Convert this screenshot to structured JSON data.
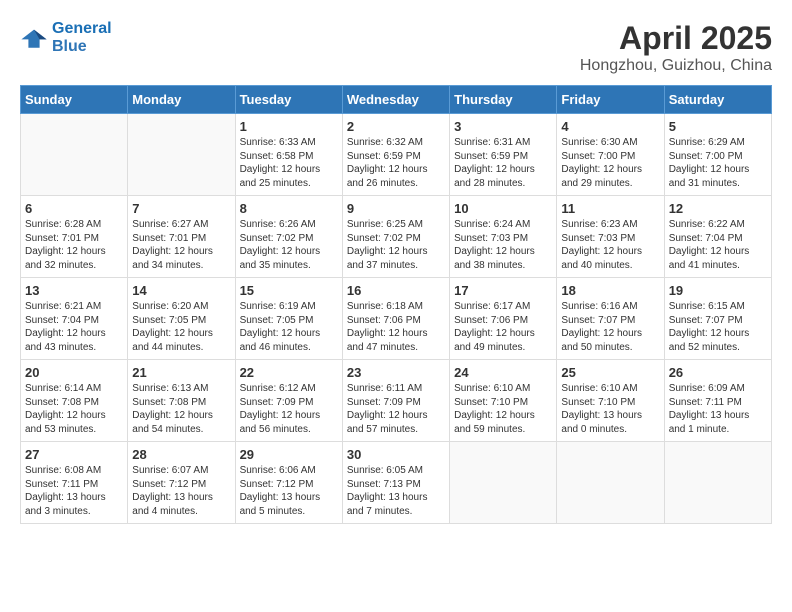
{
  "header": {
    "logo_line1": "General",
    "logo_line2": "Blue",
    "month": "April 2025",
    "location": "Hongzhou, Guizhou, China"
  },
  "days_of_week": [
    "Sunday",
    "Monday",
    "Tuesday",
    "Wednesday",
    "Thursday",
    "Friday",
    "Saturday"
  ],
  "weeks": [
    [
      {
        "day": "",
        "info": ""
      },
      {
        "day": "",
        "info": ""
      },
      {
        "day": "1",
        "info": "Sunrise: 6:33 AM\nSunset: 6:58 PM\nDaylight: 12 hours\nand 25 minutes."
      },
      {
        "day": "2",
        "info": "Sunrise: 6:32 AM\nSunset: 6:59 PM\nDaylight: 12 hours\nand 26 minutes."
      },
      {
        "day": "3",
        "info": "Sunrise: 6:31 AM\nSunset: 6:59 PM\nDaylight: 12 hours\nand 28 minutes."
      },
      {
        "day": "4",
        "info": "Sunrise: 6:30 AM\nSunset: 7:00 PM\nDaylight: 12 hours\nand 29 minutes."
      },
      {
        "day": "5",
        "info": "Sunrise: 6:29 AM\nSunset: 7:00 PM\nDaylight: 12 hours\nand 31 minutes."
      }
    ],
    [
      {
        "day": "6",
        "info": "Sunrise: 6:28 AM\nSunset: 7:01 PM\nDaylight: 12 hours\nand 32 minutes."
      },
      {
        "day": "7",
        "info": "Sunrise: 6:27 AM\nSunset: 7:01 PM\nDaylight: 12 hours\nand 34 minutes."
      },
      {
        "day": "8",
        "info": "Sunrise: 6:26 AM\nSunset: 7:02 PM\nDaylight: 12 hours\nand 35 minutes."
      },
      {
        "day": "9",
        "info": "Sunrise: 6:25 AM\nSunset: 7:02 PM\nDaylight: 12 hours\nand 37 minutes."
      },
      {
        "day": "10",
        "info": "Sunrise: 6:24 AM\nSunset: 7:03 PM\nDaylight: 12 hours\nand 38 minutes."
      },
      {
        "day": "11",
        "info": "Sunrise: 6:23 AM\nSunset: 7:03 PM\nDaylight: 12 hours\nand 40 minutes."
      },
      {
        "day": "12",
        "info": "Sunrise: 6:22 AM\nSunset: 7:04 PM\nDaylight: 12 hours\nand 41 minutes."
      }
    ],
    [
      {
        "day": "13",
        "info": "Sunrise: 6:21 AM\nSunset: 7:04 PM\nDaylight: 12 hours\nand 43 minutes."
      },
      {
        "day": "14",
        "info": "Sunrise: 6:20 AM\nSunset: 7:05 PM\nDaylight: 12 hours\nand 44 minutes."
      },
      {
        "day": "15",
        "info": "Sunrise: 6:19 AM\nSunset: 7:05 PM\nDaylight: 12 hours\nand 46 minutes."
      },
      {
        "day": "16",
        "info": "Sunrise: 6:18 AM\nSunset: 7:06 PM\nDaylight: 12 hours\nand 47 minutes."
      },
      {
        "day": "17",
        "info": "Sunrise: 6:17 AM\nSunset: 7:06 PM\nDaylight: 12 hours\nand 49 minutes."
      },
      {
        "day": "18",
        "info": "Sunrise: 6:16 AM\nSunset: 7:07 PM\nDaylight: 12 hours\nand 50 minutes."
      },
      {
        "day": "19",
        "info": "Sunrise: 6:15 AM\nSunset: 7:07 PM\nDaylight: 12 hours\nand 52 minutes."
      }
    ],
    [
      {
        "day": "20",
        "info": "Sunrise: 6:14 AM\nSunset: 7:08 PM\nDaylight: 12 hours\nand 53 minutes."
      },
      {
        "day": "21",
        "info": "Sunrise: 6:13 AM\nSunset: 7:08 PM\nDaylight: 12 hours\nand 54 minutes."
      },
      {
        "day": "22",
        "info": "Sunrise: 6:12 AM\nSunset: 7:09 PM\nDaylight: 12 hours\nand 56 minutes."
      },
      {
        "day": "23",
        "info": "Sunrise: 6:11 AM\nSunset: 7:09 PM\nDaylight: 12 hours\nand 57 minutes."
      },
      {
        "day": "24",
        "info": "Sunrise: 6:10 AM\nSunset: 7:10 PM\nDaylight: 12 hours\nand 59 minutes."
      },
      {
        "day": "25",
        "info": "Sunrise: 6:10 AM\nSunset: 7:10 PM\nDaylight: 13 hours\nand 0 minutes."
      },
      {
        "day": "26",
        "info": "Sunrise: 6:09 AM\nSunset: 7:11 PM\nDaylight: 13 hours\nand 1 minute."
      }
    ],
    [
      {
        "day": "27",
        "info": "Sunrise: 6:08 AM\nSunset: 7:11 PM\nDaylight: 13 hours\nand 3 minutes."
      },
      {
        "day": "28",
        "info": "Sunrise: 6:07 AM\nSunset: 7:12 PM\nDaylight: 13 hours\nand 4 minutes."
      },
      {
        "day": "29",
        "info": "Sunrise: 6:06 AM\nSunset: 7:12 PM\nDaylight: 13 hours\nand 5 minutes."
      },
      {
        "day": "30",
        "info": "Sunrise: 6:05 AM\nSunset: 7:13 PM\nDaylight: 13 hours\nand 7 minutes."
      },
      {
        "day": "",
        "info": ""
      },
      {
        "day": "",
        "info": ""
      },
      {
        "day": "",
        "info": ""
      }
    ]
  ]
}
